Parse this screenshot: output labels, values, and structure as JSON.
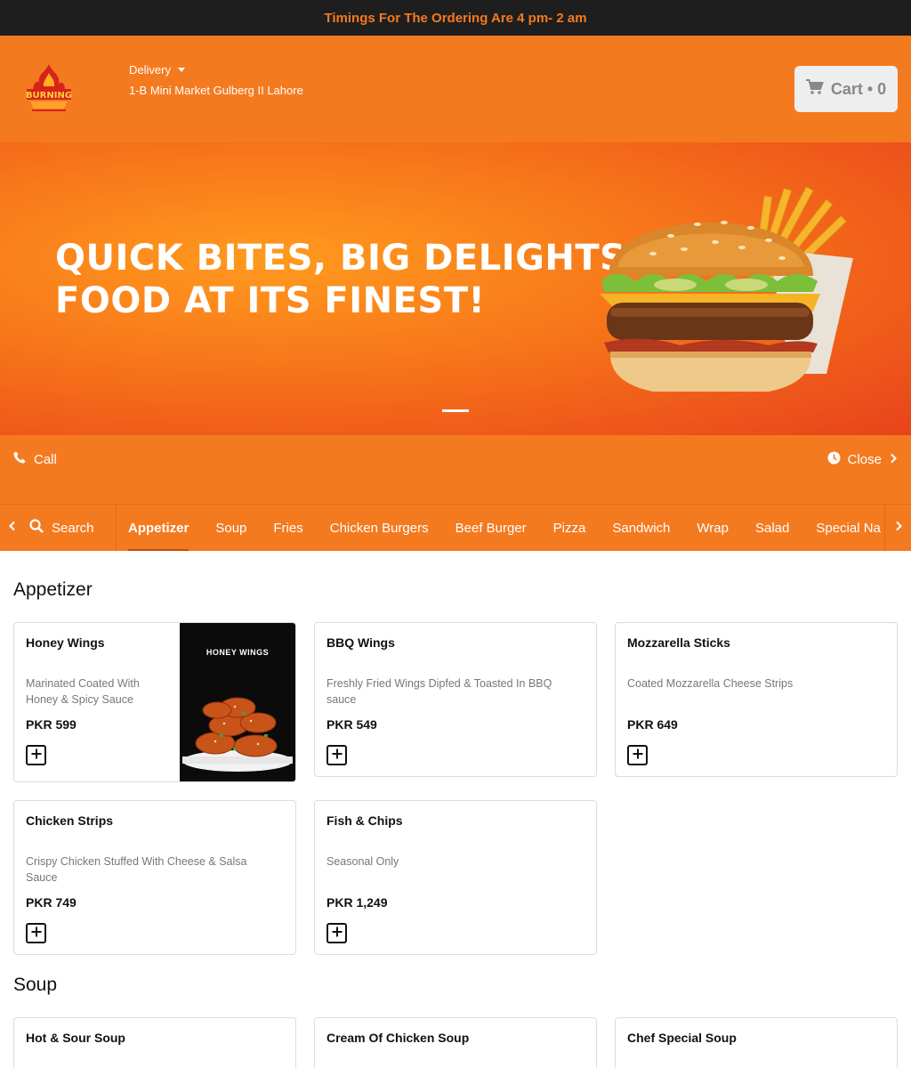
{
  "topbar": {
    "text": "Timings For The Ordering Are 4 pm- 2 am"
  },
  "header": {
    "logo_icon": "burning-flame-logo",
    "delivery_label": "Delivery",
    "address": "1-B Mini Market Gulberg II Lahore",
    "cart_label": "Cart • 0"
  },
  "banner": {
    "line1": "QUICK BITES, BIG DELIGHTS",
    "line2": "FOOD AT ITS FINEST!"
  },
  "info": {
    "call_label": "Call",
    "status_label": "Close"
  },
  "nav": {
    "search_label": "Search",
    "categories": [
      "Appetizer",
      "Soup",
      "Fries",
      "Chicken Burgers",
      "Beef Burger",
      "Pizza",
      "Sandwich",
      "Wrap",
      "Salad",
      "Special Na"
    ],
    "active": "Appetizer"
  },
  "sections": [
    {
      "title": "Appetizer",
      "items": [
        {
          "name": "Honey Wings",
          "desc_line1": "Marinated Coated With",
          "desc_line2": "Honey & Spicy Sauce",
          "price": "PKR 599",
          "image_title": "HONEY WINGS"
        },
        {
          "name": "BBQ Wings",
          "desc_line1": "Freshly Fried Wings Dipfed & Toasted In BBQ",
          "desc_line2": "sauce",
          "price": "PKR 549"
        },
        {
          "name": "Mozzarella Sticks",
          "desc_line1": "Coated Mozzarella Cheese Strips",
          "desc_line2": "",
          "price": "PKR 649"
        },
        {
          "name": "Chicken Strips",
          "desc_line1": "Crispy Chicken Stuffed With Cheese & Salsa",
          "desc_line2": "Sauce",
          "price": "PKR 749"
        },
        {
          "name": "Fish & Chips",
          "desc_line1": "Seasonal Only",
          "desc_line2": "",
          "price": "PKR 1,249"
        }
      ]
    },
    {
      "title": "Soup",
      "items": [
        {
          "name": "Hot & Sour Soup"
        },
        {
          "name": "Cream Of Chicken Soup"
        },
        {
          "name": "Chef Special Soup"
        }
      ]
    }
  ],
  "colors": {
    "brand_orange": "#f47a20",
    "topbar_bg": "#1e1e1e"
  }
}
